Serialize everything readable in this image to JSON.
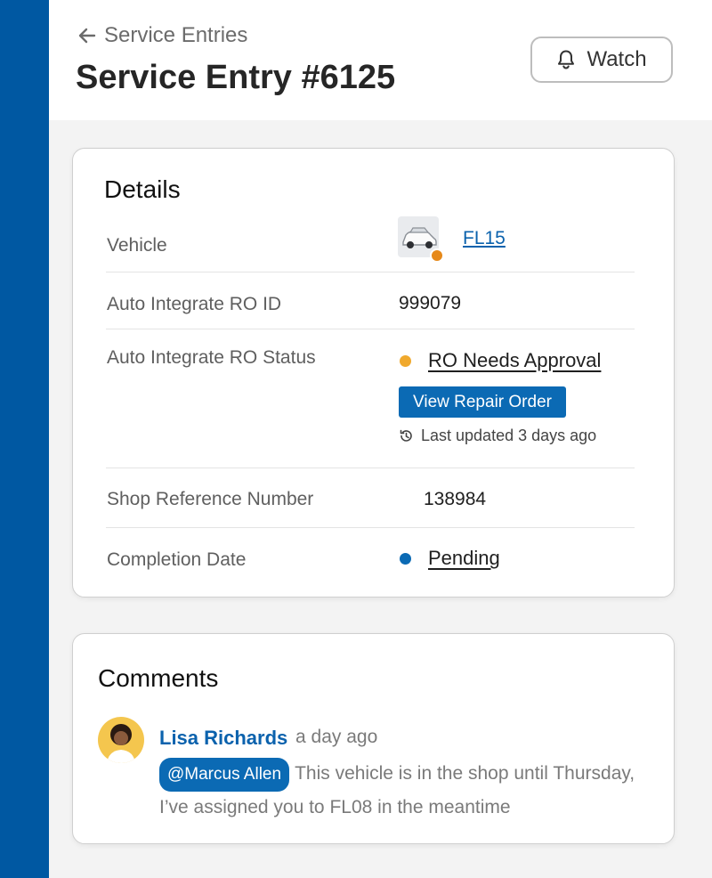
{
  "header": {
    "back_label": "Service Entries",
    "title": "Service Entry #6125",
    "watch_label": "Watch"
  },
  "details": {
    "title": "Details",
    "vehicle": {
      "label": "Vehicle",
      "value": "FL15",
      "status_color": "#e6891a"
    },
    "ro_id": {
      "label": "Auto Integrate RO ID",
      "value": "999079"
    },
    "ro_status": {
      "label": "Auto Integrate RO Status",
      "value": "RO Needs Approval",
      "status_color": "#f0a92d",
      "button_label": "View Repair Order",
      "last_updated": "Last updated 3 days ago"
    },
    "shop_ref": {
      "label": "Shop Reference Number",
      "value": "138984"
    },
    "completion": {
      "label": "Completion Date",
      "value": "Pending",
      "status_color": "#0b6ab4"
    }
  },
  "comments": {
    "title": "Comments",
    "items": [
      {
        "author": "Lisa Richards",
        "time": "a day ago",
        "mention": "@Marcus Allen",
        "text": "This vehicle is in the shop until Thursday, I’ve assigned you to FL08 in the meantime"
      }
    ]
  },
  "colors": {
    "sidebar": "#0058a2",
    "accent": "#0b6ab4",
    "link": "#0b62ad"
  }
}
